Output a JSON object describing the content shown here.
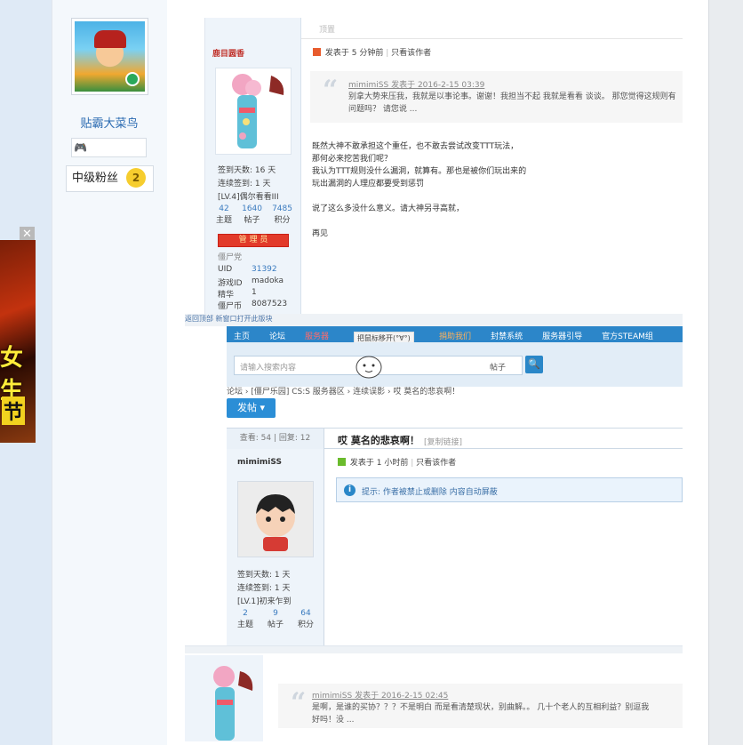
{
  "ad": {
    "text1": "女生",
    "text2": "节",
    "close_label": "✕"
  },
  "profile": {
    "username": "贴霸大菜鸟",
    "rank_label": "中级粉丝",
    "rank_level": "2"
  },
  "post1": {
    "poster_name": "鹿目圆香",
    "top_label": "顶置",
    "posted_at": "发表于 5 分钟前",
    "author_only": "只看该作者",
    "stats": [
      {
        "label": "签到天数: 16 天"
      },
      {
        "label": "连续签到: 1 天"
      },
      {
        "label": "[LV.4]偶尔看看III"
      }
    ],
    "counts": [
      {
        "num": "42",
        "label": "主题"
      },
      {
        "num": "1640",
        "label": "帖子"
      },
      {
        "num": "7485",
        "label": "积分"
      }
    ],
    "role_badge": "管 理 员",
    "group": "僵尸党",
    "fields": [
      {
        "k": "UID",
        "v": "31392"
      },
      {
        "k": "游戏ID",
        "v": "madoka"
      },
      {
        "k": "精华",
        "v": "1"
      },
      {
        "k": "僵尸币",
        "v": "8087523"
      }
    ],
    "quote_author": "mimimiSS 发表于 2016-2-15 03:39",
    "quote_text": "别拿大势来压我，我就是以事论事。谢谢！我担当不起 我就是看看 谈谈。 那您觉得这规则有问题吗？ 请您说 ...",
    "body_lines": [
      "既然大神不敢承担这个重任，也不敢去尝试改变TTT玩法，",
      "那何必来挖苦我们呢？",
      "我认为TTT规则没什么漏洞，就算有。那也是被你们玩出来的",
      "玩出漏洞的人理应都要受到惩罚",
      "",
      "说了这么多没什么意义。请大神另寻高就，",
      "",
      "再见"
    ]
  },
  "forum": {
    "top_strip": "返回顶部  新窗口打开此版块",
    "nav_items": [
      "主页",
      "论坛",
      "服务器",
      "把鼠标移开(°∀°)",
      "捐助我们",
      "封禁系统",
      "服务器引导",
      "官方STEAM组"
    ],
    "bubble": "把鼠标移开(°∀°)",
    "search_placeholder": "请输入搜索内容",
    "search_scope": "帖子",
    "search_icon_label": "🔍",
    "breadcrumb": "论坛 › [僵尸乐园] CS:S 服务器区 › 连续误影 › 哎 莫名的悲哀啊！",
    "post_button": "发帖 ▾",
    "views_label": "查看: 54 | 回复: 12",
    "thread_title": "哎 莫名的悲哀啊！",
    "copy_link": "[复制链接]",
    "poster_name": "mimimiSS",
    "posted_at": "发表于 1 小时前",
    "author_only": "只看该作者",
    "stats": [
      {
        "label": "签到天数: 1 天"
      },
      {
        "label": "连续签到: 1 天"
      },
      {
        "label": "[LV.1]初来乍到"
      }
    ],
    "counts": [
      {
        "num": "2",
        "label": "主题"
      },
      {
        "num": "9",
        "label": "帖子"
      },
      {
        "num": "64",
        "label": "积分"
      }
    ],
    "notice": "提示: 作者被禁止或删除 内容自动屏蔽"
  },
  "post3": {
    "quote_author": "mimimiSS 发表于 2016-2-15 02:45",
    "quote_text": "是啊，是谁的买协？？？不是明白 而是看清楚现状，别曲解。。 几十个老人的互相利益？别逗我 好吗！没 ..."
  }
}
